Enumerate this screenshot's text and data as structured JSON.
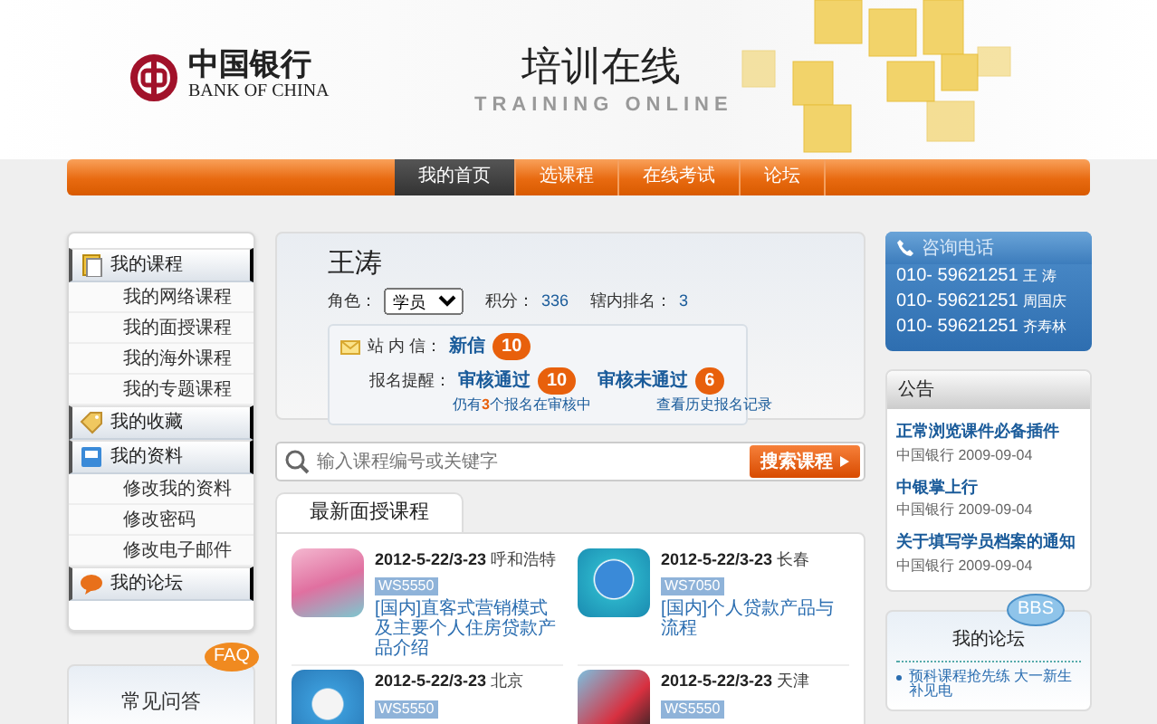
{
  "header": {
    "logo_cn": "中国银行",
    "logo_en": "BANK OF CHINA",
    "title": "培训在线",
    "subtitle": "TRAINING ONLINE"
  },
  "nav": [
    {
      "label": "我的首页",
      "selected": true
    },
    {
      "label": "选课程",
      "selected": false
    },
    {
      "label": "在线考试",
      "selected": false
    },
    {
      "label": "论坛",
      "selected": false
    }
  ],
  "sidebar": {
    "sections": [
      {
        "label": "我的课程",
        "kind": "book",
        "children": [
          "我的网络课程",
          "我的面授课程",
          "我的海外课程",
          "我的专题课程"
        ]
      },
      {
        "label": "我的收藏",
        "kind": "tag"
      },
      {
        "label": "我的资料",
        "kind": "disk",
        "children": [
          "修改我的资料",
          "修改密码",
          "修改电子邮件"
        ]
      },
      {
        "label": "我的论坛",
        "kind": "chat"
      }
    ],
    "faq": {
      "label": "常见问答",
      "badge": "FAQ"
    }
  },
  "profile": {
    "name": "王涛",
    "role_label": "角色：",
    "role": "学员",
    "points_label": "积分：",
    "points": "336",
    "rank_label": "辖内排名：",
    "rank": "3",
    "messages": {
      "label": "站 内 信：",
      "link": "新信",
      "count": "10"
    },
    "enroll": {
      "label": "报名提醒：",
      "passed": "审核通过",
      "passed_count": "10",
      "failed": "审核未通过",
      "failed_count": "6",
      "pending": "仍有**3**个报名在审核中",
      "history": "查看历史报名记录"
    }
  },
  "search": {
    "placeholder": "输入课程编号或关键字",
    "button": "搜索课程"
  },
  "courses": {
    "tab": "最新面授课程",
    "items": [
      {
        "date": "2012-5-22/3-23",
        "city": "呼和浩特",
        "code": "WS5550",
        "title": "[国内]直客式营销模式及主要个人住房贷款产品介绍",
        "kind": "pink"
      },
      {
        "date": "2012-5-22/3-23",
        "city": "长春",
        "code": "WS7050",
        "title": "[国内]个人贷款产品与流程",
        "kind": "globe"
      },
      {
        "date": "2012-5-22/3-23",
        "city": "北京",
        "code": "WS5550",
        "kind": "compass"
      },
      {
        "date": "2012-5-22/3-23",
        "city": "天津",
        "code": "WS5550",
        "kind": "red"
      }
    ]
  },
  "hotline": {
    "title": "咨询电话",
    "lines": [
      {
        "phone": "010- 59621251",
        "name": "王 涛"
      },
      {
        "phone": "010- 59621251",
        "name": "周国庆"
      },
      {
        "phone": "010- 59621251",
        "name": "齐寿林"
      }
    ]
  },
  "notices": {
    "title": "公告",
    "items": [
      {
        "title": "正常浏览课件必备插件",
        "source": "中国银行",
        "date": "2009-09-04"
      },
      {
        "title": "中银掌上行",
        "source": "中国银行",
        "date": "2009-09-04"
      },
      {
        "title": "关于填写学员档案的通知",
        "source": "中国银行",
        "date": "2009-09-04"
      }
    ]
  },
  "forum": {
    "title": "我的论坛",
    "badge": "BBS",
    "posts": [
      "预科课程抢先练 大一新生补见电"
    ]
  }
}
